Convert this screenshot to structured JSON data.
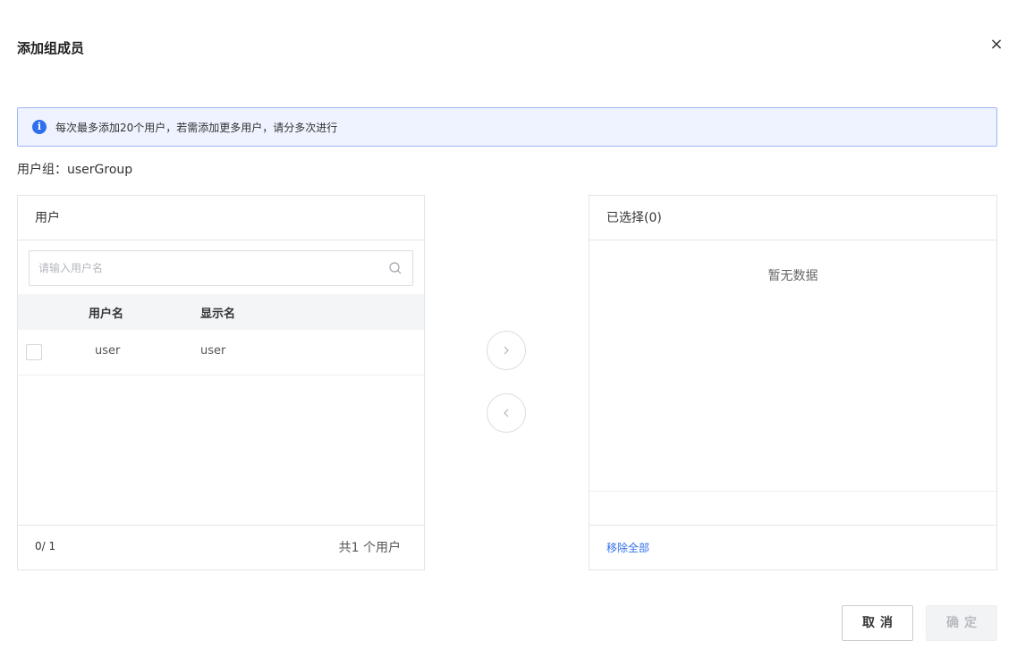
{
  "dialog": {
    "title": "添加组成员",
    "close_glyph": "×"
  },
  "alert": {
    "icon_glyph": "i",
    "text": "每次最多添加20个用户，若需添加更多用户，请分多次进行"
  },
  "group": {
    "label": "用户组：userGroup"
  },
  "left_panel": {
    "title": "用户",
    "search_placeholder": "请输入用户名",
    "columns": [
      "用户名",
      "显示名"
    ],
    "rows": [
      {
        "username": "user",
        "display_name": "user",
        "checked": false
      }
    ],
    "selected_count": "0/ 1",
    "total": "共1 个用户"
  },
  "right_panel": {
    "title": "已选择(0)",
    "empty_text": "暂无数据",
    "remove_all": "移除全部"
  },
  "buttons": {
    "cancel": "取消",
    "confirm": "确定"
  },
  "colors": {
    "accent": "#2f6fed",
    "alert_bg": "#eef3ff",
    "alert_border": "#9db6f3",
    "border": "#e3e5e9"
  }
}
